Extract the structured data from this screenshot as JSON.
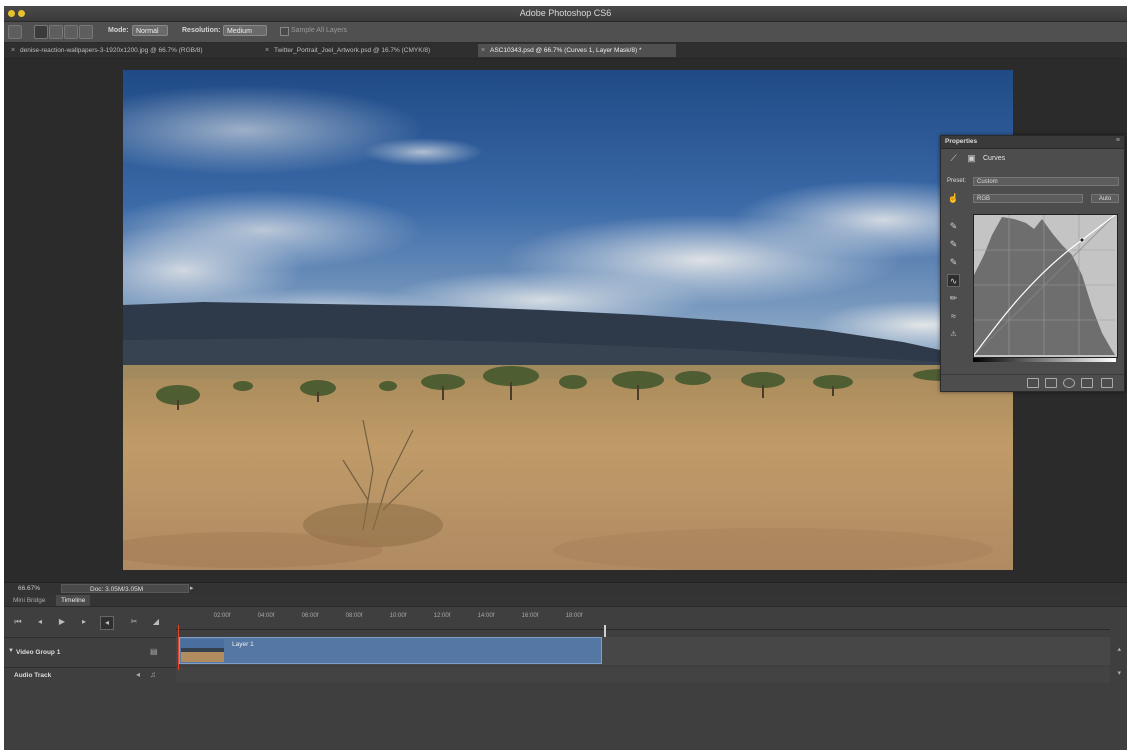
{
  "app": {
    "title": "Adobe Photoshop CS6"
  },
  "options_bar": {
    "mode_label": "Mode:",
    "mode_value": "Normal",
    "resolution_label": "Resolution:",
    "resolution_value": "Medium",
    "sample_label": "Sample All Layers"
  },
  "doc_tabs": [
    {
      "label": "denise-reaction-wallpapers-3-1920x1200.jpg @ 66.7% (RGB/8)",
      "active": false
    },
    {
      "label": "Twitter_Portrait_Joel_Artwork.psd @ 16.7% (CMYK/8)",
      "active": false
    },
    {
      "label": "ASC10343.psd @ 66.7% (Curves 1, Layer Mask/8) *",
      "active": true
    }
  ],
  "properties": {
    "title": "Properties",
    "adjustment": "Curves",
    "preset_label": "Preset:",
    "preset_value": "Custom",
    "channel_value": "RGB",
    "auto_label": "Auto"
  },
  "status": {
    "zoom": "66.67%",
    "doc_info": "Doc: 3.05M/3.05M"
  },
  "timeline": {
    "tabs": [
      "Mini Bridge",
      "Timeline"
    ],
    "active_tab": "Timeline",
    "ruler_ticks": [
      "02:00f",
      "04:00f",
      "06:00f",
      "08:00f",
      "10:00f",
      "12:00f",
      "14:00f",
      "16:00f",
      "18:00f"
    ],
    "video_group": "Video Group 1",
    "audio_track": "Audio Track",
    "clip_label": "Layer 1"
  },
  "colors": {
    "panel_bg": "#3d3d3d",
    "clip_blue": "#5577a4",
    "playhead": "#e04a2a",
    "title_dot": "#e8c12b"
  }
}
